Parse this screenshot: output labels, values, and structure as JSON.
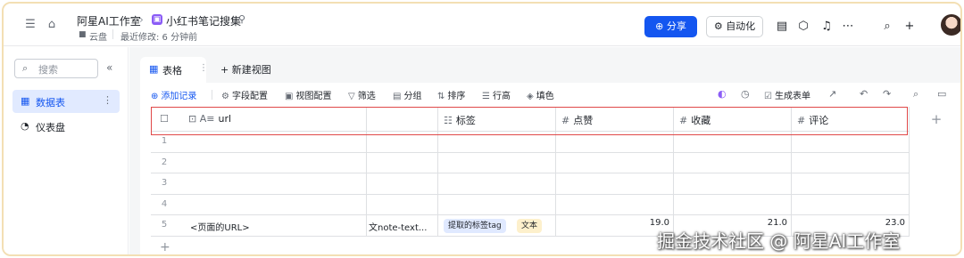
{
  "topbar": {
    "breadcrumb_workspace": "阿星AI工作室",
    "breadcrumb_sep": "›",
    "doc_title": "小红书笔记搜集",
    "location": "云盘",
    "modified": "最近修改: 6 分钟前",
    "share_label": "分享",
    "automation_label": "自动化"
  },
  "sidebar": {
    "search_placeholder": "搜索",
    "items": [
      {
        "label": "数据表",
        "active": true
      },
      {
        "label": "仪表盘",
        "active": false
      }
    ]
  },
  "view_tabs": {
    "active": "表格",
    "new_view": "新建视图"
  },
  "toolbar": {
    "add_record": "添加记录",
    "field_config": "字段配置",
    "view_config": "视图配置",
    "filter": "筛选",
    "group": "分组",
    "sort": "排序",
    "row_height": "行高",
    "fill_color": "填色",
    "generate_form": "生成表单"
  },
  "table": {
    "headers": [
      {
        "label": "url",
        "icon": "lock-text-icon"
      },
      {
        "label": "",
        "icon": ""
      },
      {
        "label": "标签",
        "icon": "list-icon"
      },
      {
        "label": "点赞",
        "icon": "hash-icon"
      },
      {
        "label": "收藏",
        "icon": "hash-icon"
      },
      {
        "label": "评论",
        "icon": "hash-icon"
      }
    ],
    "row_numbers": [
      "1",
      "2",
      "3",
      "4",
      "5"
    ],
    "row5": {
      "url": "<页面的URL>",
      "text": "文note-text...",
      "tags": [
        "提取的标签tag",
        "文本"
      ],
      "likes": "19.0",
      "favorites": "21.0",
      "comments": "23.0"
    }
  },
  "watermark": "掘金技术社区 @ 阿星AI工作室",
  "colors": {
    "accent": "#1456f0",
    "highlight_box": "#e04848",
    "sidebar_active": "#e1eaff"
  }
}
